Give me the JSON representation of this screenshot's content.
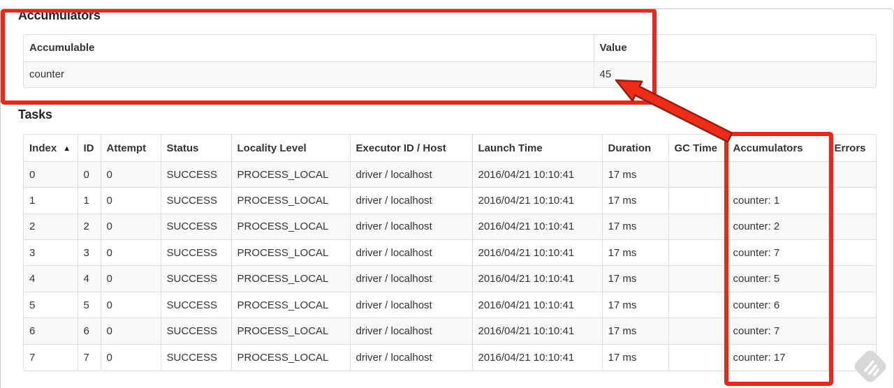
{
  "accumulators": {
    "title": "Accumulators",
    "table": {
      "headers": [
        "Accumulable",
        "Value"
      ],
      "rows": [
        [
          "counter",
          "45"
        ]
      ]
    }
  },
  "tasks": {
    "title": "Tasks",
    "table": {
      "headers": [
        "Index",
        "ID",
        "Attempt",
        "Status",
        "Locality Level",
        "Executor ID / Host",
        "Launch Time",
        "Duration",
        "GC Time",
        "Accumulators",
        "Errors"
      ],
      "sort_indicator": "▲",
      "sorted_column": "Index",
      "rows": [
        [
          "0",
          "0",
          "0",
          "SUCCESS",
          "PROCESS_LOCAL",
          "driver / localhost",
          "2016/04/21 10:10:41",
          "17 ms",
          "",
          "",
          ""
        ],
        [
          "1",
          "1",
          "0",
          "SUCCESS",
          "PROCESS_LOCAL",
          "driver / localhost",
          "2016/04/21 10:10:41",
          "17 ms",
          "",
          "counter: 1",
          ""
        ],
        [
          "2",
          "2",
          "0",
          "SUCCESS",
          "PROCESS_LOCAL",
          "driver / localhost",
          "2016/04/21 10:10:41",
          "17 ms",
          "",
          "counter: 2",
          ""
        ],
        [
          "3",
          "3",
          "0",
          "SUCCESS",
          "PROCESS_LOCAL",
          "driver / localhost",
          "2016/04/21 10:10:41",
          "17 ms",
          "",
          "counter: 7",
          ""
        ],
        [
          "4",
          "4",
          "0",
          "SUCCESS",
          "PROCESS_LOCAL",
          "driver / localhost",
          "2016/04/21 10:10:41",
          "17 ms",
          "",
          "counter: 5",
          ""
        ],
        [
          "5",
          "5",
          "0",
          "SUCCESS",
          "PROCESS_LOCAL",
          "driver / localhost",
          "2016/04/21 10:10:41",
          "17 ms",
          "",
          "counter: 6",
          ""
        ],
        [
          "6",
          "6",
          "0",
          "SUCCESS",
          "PROCESS_LOCAL",
          "driver / localhost",
          "2016/04/21 10:10:41",
          "17 ms",
          "",
          "counter: 7",
          ""
        ],
        [
          "7",
          "7",
          "0",
          "SUCCESS",
          "PROCESS_LOCAL",
          "driver / localhost",
          "2016/04/21 10:10:41",
          "17 ms",
          "",
          "counter: 17",
          ""
        ]
      ]
    }
  },
  "annotations": {
    "box_color": "#e8281a",
    "arrow_fill": "#ee2b16",
    "arrow_outline": "#8f2012"
  },
  "watermark": {
    "icon": "feedly-logo-icon",
    "color": "#d8d8d8"
  }
}
